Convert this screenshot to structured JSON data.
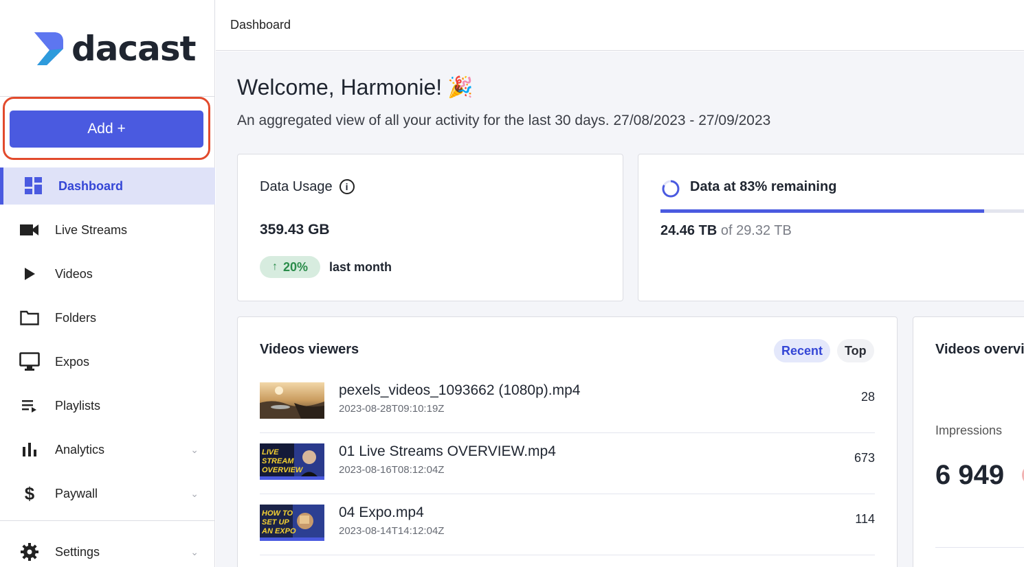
{
  "brand": {
    "name": "dacast",
    "accent": "#4a5ae0",
    "highlight_color": "#e24a2c"
  },
  "sidebar": {
    "add_label": "Add +",
    "items": [
      {
        "label": "Dashboard",
        "icon": "dashboard-icon",
        "active": true
      },
      {
        "label": "Live Streams",
        "icon": "camera-icon"
      },
      {
        "label": "Videos",
        "icon": "play-icon"
      },
      {
        "label": "Folders",
        "icon": "folder-icon"
      },
      {
        "label": "Expos",
        "icon": "monitor-icon"
      },
      {
        "label": "Playlists",
        "icon": "playlist-icon"
      },
      {
        "label": "Analytics",
        "icon": "bar-chart-icon",
        "expandable": true
      },
      {
        "label": "Paywall",
        "icon": "dollar-icon",
        "expandable": true
      },
      {
        "label": "Settings",
        "icon": "gear-icon",
        "expandable": true
      }
    ]
  },
  "header": {
    "breadcrumb": "Dashboard"
  },
  "main": {
    "welcome": "Welcome, Harmonie!",
    "welcome_emoji": "🎉",
    "subtitle": "An aggregated view of all your activity for the last 30 days. 27/08/2023 - 27/09/2023",
    "data_usage": {
      "title": "Data Usage",
      "value": "359.43  GB",
      "change": "20%",
      "change_direction": "up",
      "change_suffix": "last month"
    },
    "data_remaining": {
      "title": "Data at 83% remaining",
      "remaining_fraction": 0.83,
      "used": "24.46 TB",
      "total": "of 29.32 TB"
    },
    "videos_viewers": {
      "title": "Videos viewers",
      "tabs": [
        "Recent",
        "Top"
      ],
      "active_tab": "Recent",
      "rows": [
        {
          "name": "pexels_videos_1093662 (1080p).mp4",
          "date": "2023-08-28T09:10:19Z",
          "count": "28",
          "thumb": "landscape"
        },
        {
          "name": "01 Live Streams OVERVIEW.mp4",
          "date": "2023-08-16T08:12:04Z",
          "count": "673",
          "thumb": "live-stream-overview",
          "thumb_text": [
            "LIVE",
            "STREAM",
            "OVERVIEW"
          ]
        },
        {
          "name": "04 Expo.mp4",
          "date": "2023-08-14T14:12:04Z",
          "count": "114",
          "thumb": "how-to-expo",
          "thumb_text": [
            "HOW TO",
            "SET UP",
            "AN EXPO"
          ]
        }
      ]
    },
    "videos_overview": {
      "title": "Videos overvi",
      "impressions_label": "Impressions",
      "impressions_value": "6 949"
    }
  }
}
